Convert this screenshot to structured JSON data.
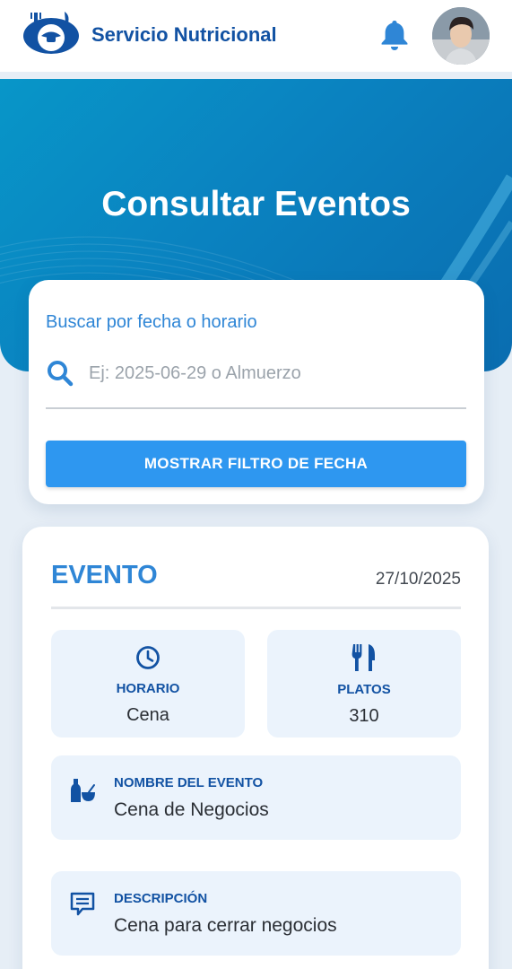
{
  "header": {
    "app_title": "Servicio Nutricional",
    "logo_icon": "food-service-logo-icon",
    "notification_icon": "bell-icon",
    "avatar": "user-avatar"
  },
  "hero": {
    "title": "Consultar Eventos"
  },
  "search": {
    "label": "Buscar por fecha o horario",
    "placeholder": "Ej: 2025-06-29 o Almuerzo",
    "value": "",
    "filter_button_label": "MOSTRAR FILTRO DE FECHA"
  },
  "event": {
    "heading": "EVENTO",
    "date": "27/10/2025",
    "schedule": {
      "label": "HORARIO",
      "value": "Cena"
    },
    "dishes": {
      "label": "PLATOS",
      "value": "310"
    },
    "name": {
      "label": "NOMBRE DEL EVENTO",
      "value": "Cena de Negocios"
    },
    "description": {
      "label": "DESCRIPCIÓN",
      "value": "Cena para cerrar negocios"
    }
  },
  "colors": {
    "brand": "#1252a3",
    "accent": "#2e97f0",
    "hero_start": "#0896c8",
    "hero_end": "#0a6db0",
    "tile_bg": "#ebf3fc"
  }
}
